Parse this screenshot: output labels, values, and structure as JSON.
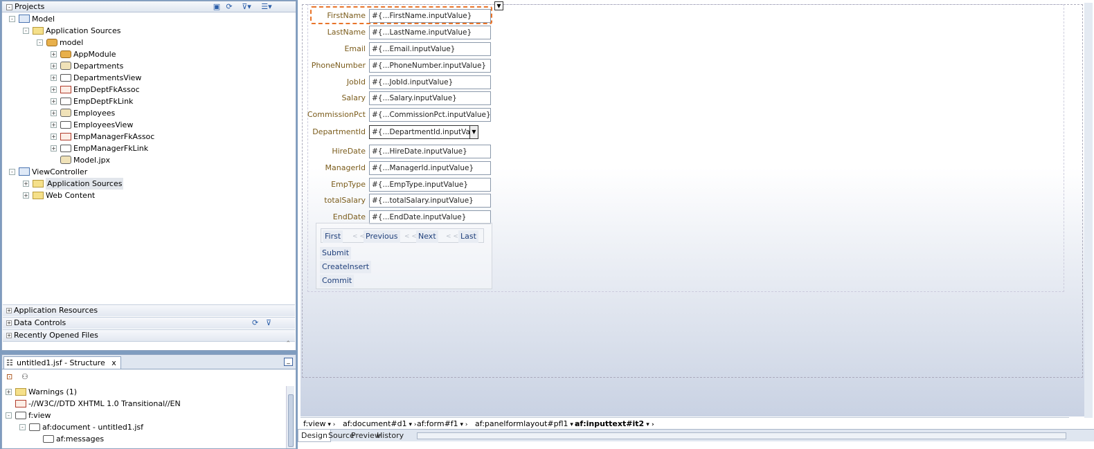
{
  "projects": {
    "title": "Projects",
    "tree": [
      {
        "label": "Model",
        "toggle": "-",
        "icon": "project",
        "indent": 0
      },
      {
        "label": "Application Sources",
        "toggle": "-",
        "icon": "folder",
        "indent": 1
      },
      {
        "label": "model",
        "toggle": "-",
        "icon": "package",
        "indent": 2
      },
      {
        "label": "AppModule",
        "toggle": "+",
        "icon": "app-module",
        "indent": 3
      },
      {
        "label": "Departments",
        "toggle": "+",
        "icon": "entity",
        "indent": 3
      },
      {
        "label": "DepartmentsView",
        "toggle": "+",
        "icon": "view-object",
        "indent": 3
      },
      {
        "label": "EmpDeptFkAssoc",
        "toggle": "+",
        "icon": "association",
        "indent": 3
      },
      {
        "label": "EmpDeptFkLink",
        "toggle": "+",
        "icon": "view-link",
        "indent": 3
      },
      {
        "label": "Employees",
        "toggle": "+",
        "icon": "entity",
        "indent": 3
      },
      {
        "label": "EmployeesView",
        "toggle": "+",
        "icon": "view-object",
        "indent": 3
      },
      {
        "label": "EmpManagerFkAssoc",
        "toggle": "+",
        "icon": "association",
        "indent": 3
      },
      {
        "label": "EmpManagerFkLink",
        "toggle": "+",
        "icon": "view-link",
        "indent": 3
      },
      {
        "label": "Model.jpx",
        "toggle": "",
        "icon": "jpx",
        "indent": 3
      },
      {
        "label": "ViewController",
        "toggle": "-",
        "icon": "project",
        "indent": 0
      },
      {
        "label": "Application Sources",
        "toggle": "+",
        "icon": "folder",
        "indent": 1,
        "selected": true
      },
      {
        "label": "Web Content",
        "toggle": "+",
        "icon": "folder",
        "indent": 1
      }
    ]
  },
  "accordions": [
    "Application Resources",
    "Data Controls",
    "Recently Opened Files"
  ],
  "structure": {
    "tab_title": "untitled1.jsf - Structure",
    "close": "x",
    "tree": [
      {
        "label": "Warnings (1)",
        "toggle": "+",
        "icon": "folder",
        "indent": 0
      },
      {
        "label": "-//W3C//DTD XHTML 1.0 Transitional//EN",
        "toggle": "",
        "icon": "doctype",
        "indent": 0
      },
      {
        "label": "f:view",
        "toggle": "-",
        "icon": "view",
        "indent": 0
      },
      {
        "label": "af:document - untitled1.jsf",
        "toggle": "-",
        "icon": "document",
        "indent": 1
      },
      {
        "label": "af:messages",
        "toggle": "",
        "icon": "messages",
        "indent": 2
      }
    ]
  },
  "form": {
    "fields": [
      {
        "label": "FirstName",
        "value": "#{...FirstName.inputValue}",
        "selected": true
      },
      {
        "label": "LastName",
        "value": "#{...LastName.inputValue}"
      },
      {
        "label": "Email",
        "value": "#{...Email.inputValue}"
      },
      {
        "label": "PhoneNumber",
        "value": "#{...PhoneNumber.inputValue}"
      },
      {
        "label": "JobId",
        "value": "#{...JobId.inputValue}"
      },
      {
        "label": "Salary",
        "value": "#{...Salary.inputValue}"
      },
      {
        "label": "CommissionPct",
        "value": "#{...CommissionPct.inputValue}"
      },
      {
        "label": "DepartmentId",
        "value": "#{...DepartmentId.inputValue}",
        "select": true
      },
      {
        "label": "HireDate",
        "value": "#{...HireDate.inputValue}"
      },
      {
        "label": "ManagerId",
        "value": "#{...ManagerId.inputValue}"
      },
      {
        "label": "EmpType",
        "value": "#{...EmpType.inputValue}"
      },
      {
        "label": "totalSalary",
        "value": "#{...totalSalary.inputValue}"
      },
      {
        "label": "EndDate",
        "value": "#{...EndDate.inputValue}"
      }
    ],
    "nav_buttons": [
      "First",
      "Previous",
      "Next",
      "Last"
    ],
    "nav_separators": [
      "< <",
      "< <",
      "< <"
    ],
    "action_buttons": [
      "Submit",
      "CreateInsert",
      "Commit"
    ]
  },
  "breadcrumbs": [
    "f:view",
    "af:document#d1",
    "af:form#f1",
    "af:panelformlayout#pfl1",
    "af:inputtext#it2"
  ],
  "editor_tabs": [
    "Design",
    "Source",
    "Preview",
    "History"
  ],
  "active_editor_tab": "Design",
  "colors": {
    "label": "#7a5b1a",
    "button_text": "#1f3f7a",
    "selection_outline": "#e8742a"
  }
}
